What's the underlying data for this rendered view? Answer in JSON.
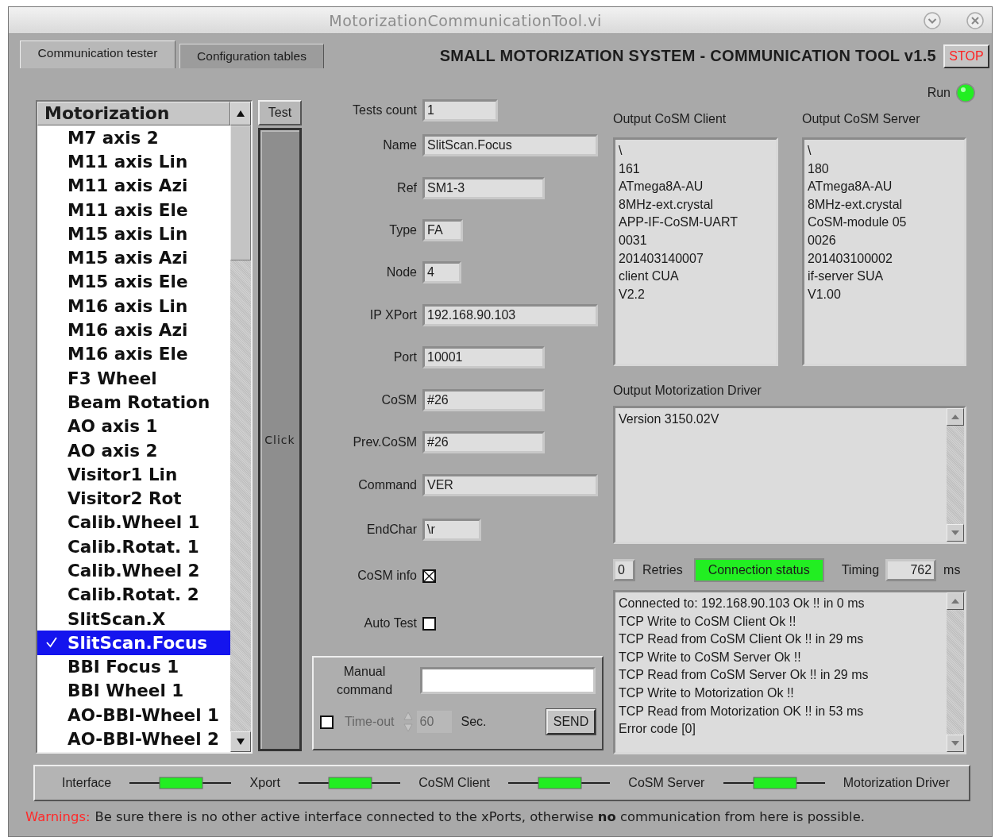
{
  "window": {
    "title": "MotorizationCommunicationTool.vi"
  },
  "tabs": [
    {
      "label": "Communication tester",
      "selected": true
    },
    {
      "label": "Configuration tables",
      "selected": false
    }
  ],
  "header": {
    "title": "SMALL MOTORIZATION SYSTEM - COMMUNICATION TOOL v1.5",
    "stop_button": "STOP"
  },
  "motorization_list": {
    "title": "Motorization",
    "items": [
      {
        "label": "M7 axis 2",
        "selected": false
      },
      {
        "label": "M11 axis Lin",
        "selected": false
      },
      {
        "label": "M11 axis Azi",
        "selected": false
      },
      {
        "label": "M11 axis Ele",
        "selected": false
      },
      {
        "label": "M15 axis Lin",
        "selected": false
      },
      {
        "label": "M15 axis Azi",
        "selected": false
      },
      {
        "label": "M15 axis Ele",
        "selected": false
      },
      {
        "label": "M16 axis Lin",
        "selected": false
      },
      {
        "label": "M16 axis Azi",
        "selected": false
      },
      {
        "label": "M16 axis Ele",
        "selected": false
      },
      {
        "label": "F3 Wheel",
        "selected": false
      },
      {
        "label": "Beam Rotation",
        "selected": false
      },
      {
        "label": "AO axis 1",
        "selected": false
      },
      {
        "label": "AO axis 2",
        "selected": false
      },
      {
        "label": "Visitor1 Lin",
        "selected": false
      },
      {
        "label": "Visitor2 Rot",
        "selected": false
      },
      {
        "label": "Calib.Wheel 1",
        "selected": false
      },
      {
        "label": "Calib.Rotat. 1",
        "selected": false
      },
      {
        "label": "Calib.Wheel 2",
        "selected": false
      },
      {
        "label": "Calib.Rotat. 2",
        "selected": false
      },
      {
        "label": "SlitScan.X",
        "selected": false
      },
      {
        "label": "SlitScan.Focus",
        "selected": true
      },
      {
        "label": "BBI Focus 1",
        "selected": false
      },
      {
        "label": "BBI Wheel 1",
        "selected": false
      },
      {
        "label": "AO-BBI-Wheel 1",
        "selected": false
      },
      {
        "label": "AO-BBI-Wheel 2",
        "selected": false
      }
    ]
  },
  "test": {
    "label": "Test",
    "button": "Click"
  },
  "fields": [
    {
      "label": "Tests count",
      "value": "1"
    },
    {
      "label": "Name",
      "value": "SlitScan.Focus"
    },
    {
      "label": "Ref",
      "value": "SM1-3"
    },
    {
      "label": "Type",
      "value": "FA"
    },
    {
      "label": "Node",
      "value": "4"
    },
    {
      "label": "IP XPort",
      "value": "192.168.90.103"
    },
    {
      "label": "Port",
      "value": "10001"
    },
    {
      "label": "CoSM",
      "value": "#26"
    },
    {
      "label": "Prev.CoSM",
      "value": "#26"
    },
    {
      "label": "Command",
      "value": "VER"
    },
    {
      "label": "EndChar",
      "value": "\\r"
    }
  ],
  "checkboxes": [
    {
      "label": "CoSM info",
      "checked": true
    },
    {
      "label": "Auto Test",
      "checked": false
    }
  ],
  "manual_command": {
    "label": "Manual command",
    "timeout_checked": false,
    "timeout_disabled": true,
    "timeout_label": "Time-out",
    "timeout_value": "60",
    "unit": "Sec.",
    "send_button": "SEND"
  },
  "run_indicator": {
    "label": "Run",
    "on": true
  },
  "output_client": {
    "title": "Output CoSM Client",
    "lines": [
      "\\",
      "161",
      "ATmega8A-AU",
      "8MHz-ext.crystal",
      "APP-IF-CoSM-UART",
      "0031",
      "201403140007",
      "client CUA",
      "V2.2"
    ]
  },
  "output_server": {
    "title": "Output CoSM Server",
    "lines": [
      "\\",
      "180",
      "ATmega8A-AU",
      "8MHz-ext.crystal",
      "CoSM-module 05",
      "0026",
      "201403100002",
      "if-server SUA",
      "V1.00"
    ]
  },
  "output_driver": {
    "title": "Output Motorization Driver",
    "lines": [
      "Version 3150.02V"
    ]
  },
  "status": {
    "retries": "0",
    "retries_label": "Retries",
    "connection_status": {
      "label": "Connection status",
      "on": true
    },
    "timing_label": "Timing",
    "timing": "762",
    "unit": "ms"
  },
  "log": {
    "lines": [
      "Connected to: 192.168.90.103 Ok !! in 0 ms",
      "TCP Write to CoSM Client Ok !!",
      "TCP Read from CoSM Client Ok !! in 29 ms",
      "TCP Write to CoSM Server Ok !!",
      "TCP Read from CoSM Server Ok !! in 29 ms",
      "TCP Write to Motorization Ok !!",
      "TCP Read from Motorization OK !! in 53 ms",
      "Error code [0]"
    ]
  },
  "chain": {
    "nodes": [
      "Interface",
      "Xport",
      "CoSM Client",
      "CoSM Server",
      "Motorization Driver"
    ],
    "links": [
      {
        "on": true
      },
      {
        "on": true
      },
      {
        "on": true
      },
      {
        "on": true
      }
    ]
  },
  "warning": {
    "label": "Warnings:",
    "text": "Be sure there is no other active interface connected to the xPorts, otherwise **no** communication from here is possible."
  }
}
